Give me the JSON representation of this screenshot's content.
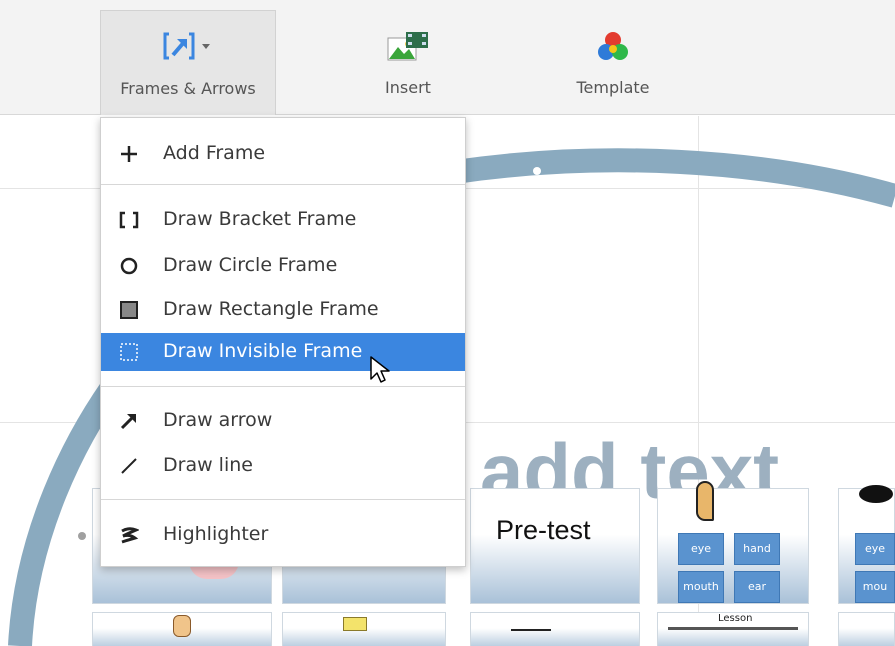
{
  "toolbar": {
    "items": [
      {
        "label": "Frames & Arrows",
        "icon": "frames-arrows-icon",
        "active": true
      },
      {
        "label": "Insert",
        "icon": "insert-image-icon",
        "active": false
      },
      {
        "label": "Template",
        "icon": "template-icon",
        "active": false
      }
    ]
  },
  "menu": {
    "items": [
      {
        "label": "Add Frame",
        "icon": "plus-icon"
      },
      {
        "label": "Draw Bracket Frame",
        "icon": "bracket-icon"
      },
      {
        "label": "Draw Circle Frame",
        "icon": "circle-icon"
      },
      {
        "label": "Draw Rectangle Frame",
        "icon": "rectangle-icon"
      },
      {
        "label": "Draw Invisible Frame",
        "icon": "dashed-rectangle-icon",
        "selected": true
      },
      {
        "label": "Draw arrow",
        "icon": "arrow-icon"
      },
      {
        "label": "Draw line",
        "icon": "line-icon"
      },
      {
        "label": "Highlighter",
        "icon": "highlighter-icon"
      }
    ]
  },
  "canvas": {
    "background_text": "add text",
    "thumbnails": {
      "pretest_title": "Pre-test",
      "words_1": [
        "eye",
        "hand",
        "mouth",
        "ear"
      ],
      "words_2": [
        "eye",
        "mou"
      ],
      "lesson_label": "Lesson"
    }
  },
  "colors": {
    "accent": "#3b86e0",
    "circle_path": "#8aaabf",
    "word_button": "#5a93cf"
  }
}
